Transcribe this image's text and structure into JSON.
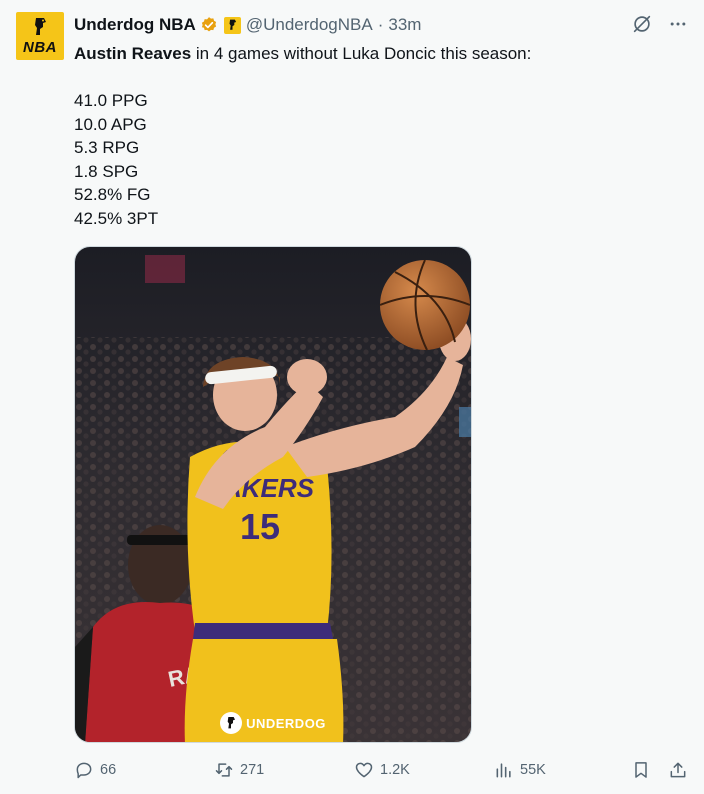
{
  "author": {
    "name": "Underdog NBA",
    "handle": "@UnderdogNBA",
    "separator": "·",
    "time": "33m",
    "avatar_text": "NBA",
    "verified_color": "#e8a10f",
    "avatar_color": "#f5c518"
  },
  "tweet": {
    "bold_name": "Austin Reaves",
    "text_rest": " in 4 games without Luka Doncic this season:",
    "stats": [
      "41.0 PPG",
      "10.0 APG",
      "5.3 RPG",
      "1.8 SPG",
      "52.8% FG",
      "42.5% 3PT"
    ]
  },
  "media": {
    "jersey_text": "AKERS",
    "jersey_number": "15",
    "watermark": "UNDERDOG",
    "icons": [
      "basketball",
      "player-photo"
    ]
  },
  "actions": {
    "replies": "66",
    "reposts": "271",
    "likes": "1.2K",
    "views": "55K"
  },
  "header_icons": [
    "grok-icon",
    "more-icon"
  ]
}
